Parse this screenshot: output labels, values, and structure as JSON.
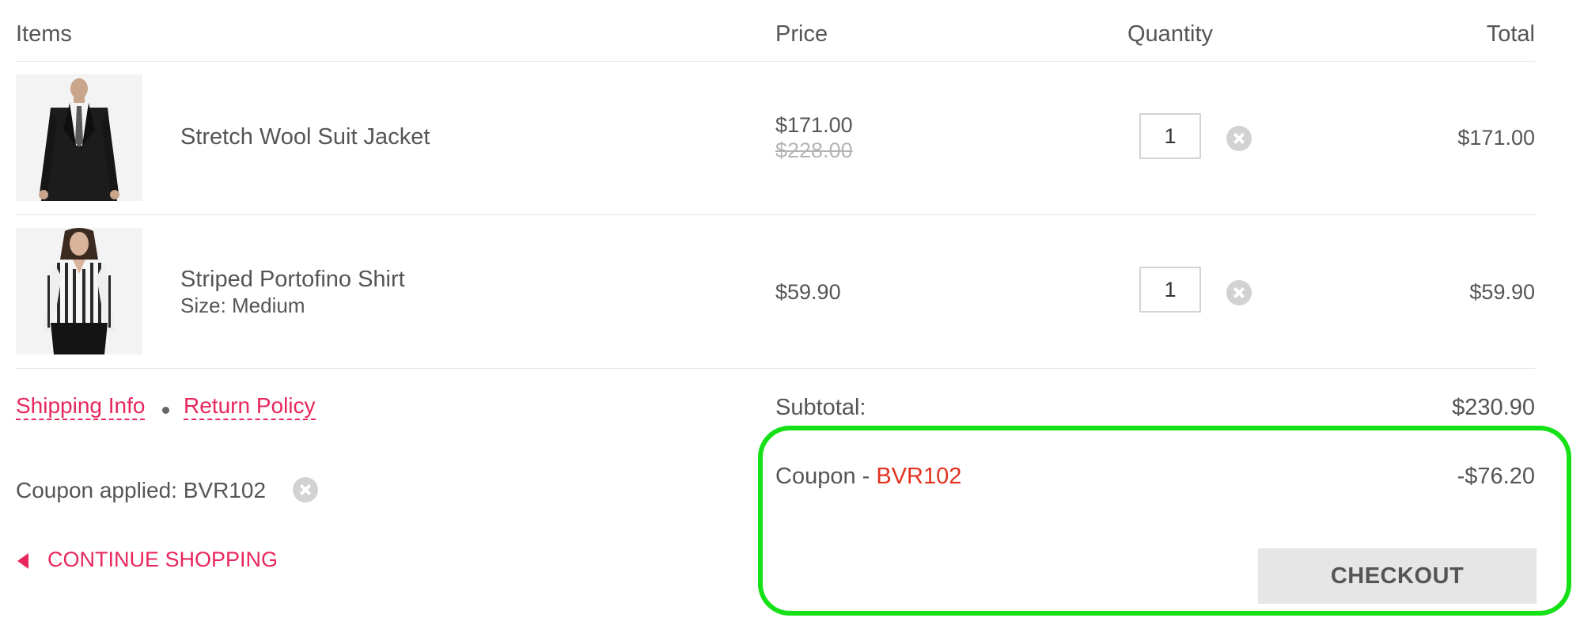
{
  "headers": {
    "items": "Items",
    "price": "Price",
    "quantity": "Quantity",
    "total": "Total"
  },
  "items": [
    {
      "name": "Stretch Wool Suit Jacket",
      "size": "",
      "price": "$171.00",
      "original_price": "$228.00",
      "quantity": "1",
      "total": "$171.00",
      "image": "suit-jacket-photo"
    },
    {
      "name": "Striped Portofino Shirt",
      "size": "Size: Medium",
      "price": "$59.90",
      "original_price": "",
      "quantity": "1",
      "total": "$59.90",
      "image": "striped-shirt-photo"
    }
  ],
  "links": {
    "shipping_info": "Shipping Info",
    "return_policy": "Return Policy"
  },
  "coupon": {
    "applied_text": "Coupon applied: BVR102",
    "label_prefix": "Coupon - ",
    "code": "BVR102",
    "discount": "-$76.20"
  },
  "summary": {
    "subtotal_label": "Subtotal:",
    "subtotal_value": "$230.90"
  },
  "actions": {
    "continue_shopping": "CONTINUE SHOPPING",
    "checkout": "CHECKOUT"
  },
  "colors": {
    "accent_pink": "#e8275c",
    "coupon_red": "#e2321f",
    "highlight_green": "#16e016",
    "button_gray": "#e6e6e6"
  }
}
